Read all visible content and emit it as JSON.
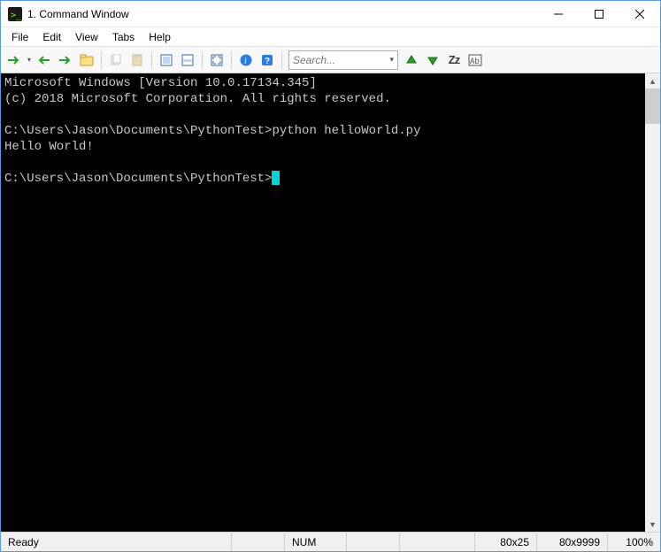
{
  "window": {
    "title": "1. Command Window"
  },
  "menubar": {
    "items": [
      "File",
      "Edit",
      "View",
      "Tabs",
      "Help"
    ]
  },
  "toolbar": {
    "search_placeholder": "Search..."
  },
  "terminal": {
    "lines": [
      "Microsoft Windows [Version 10.0.17134.345]",
      "(c) 2018 Microsoft Corporation. All rights reserved.",
      "",
      "C:\\Users\\Jason\\Documents\\PythonTest>python helloWorld.py",
      "Hello World!",
      "",
      "C:\\Users\\Jason\\Documents\\PythonTest>"
    ]
  },
  "statusbar": {
    "ready": "Ready",
    "num": "NUM",
    "viewport": "80x25",
    "buffer": "80x9999",
    "zoom": "100%"
  }
}
